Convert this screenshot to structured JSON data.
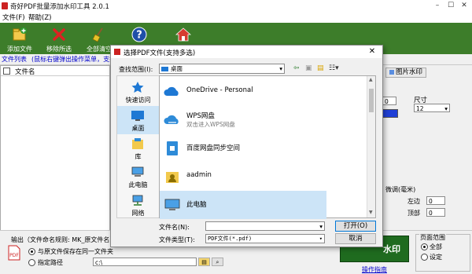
{
  "app": {
    "title": "奇好PDF批量添加水印工具 2.0.1",
    "menu": [
      "文件(F)",
      "帮助(Z)"
    ]
  },
  "toolbar": {
    "items": [
      {
        "label": "添加文件",
        "icon": "add-file-icon"
      },
      {
        "label": "移除所选",
        "icon": "remove-icon"
      },
      {
        "label": "全部清空",
        "icon": "broom-icon"
      },
      {
        "label": "",
        "icon": "help-icon"
      },
      {
        "label": "",
        "icon": "home-icon"
      }
    ]
  },
  "file_list": {
    "tab_label": "文件列表",
    "hint": "(鼠标右键弹出操作菜单，支持",
    "column_filename": "文件名"
  },
  "right_panel": {
    "image_watermark_tab": "图片水印",
    "size_label": "尺寸",
    "size_value": "12",
    "zero_value": "0",
    "margin_label": "微调(毫米)",
    "left_label": "左边",
    "top_label": "顶部",
    "left_value": "0",
    "top_value": "0",
    "page_range_label": "页面范围",
    "page_range_options": [
      "全部",
      "设定"
    ],
    "start_button": "水印",
    "guide_link": "操作指南"
  },
  "output": {
    "label": "输出（文件命名规则: MK_原文件名）",
    "option_same_folder": "与原文件保存在同一文件夹",
    "option_custom_path": "指定路径",
    "path_value": "c:\\"
  },
  "dialog": {
    "title": "选择PDF文件(支持多选)",
    "lookin_label": "查找范围(I):",
    "lookin_value": "桌面",
    "places": [
      {
        "label": "快速访问",
        "icon": "quick-access-icon"
      },
      {
        "label": "桌面",
        "icon": "desktop-icon"
      },
      {
        "label": "库",
        "icon": "library-icon"
      },
      {
        "label": "此电脑",
        "icon": "this-pc-icon"
      },
      {
        "label": "网络",
        "icon": "network-icon"
      }
    ],
    "files": [
      {
        "name": "OneDrive - Personal",
        "sub": "",
        "icon": "onedrive-icon"
      },
      {
        "name": "WPS网盘",
        "sub": "双击进入WPS网盘",
        "icon": "wps-cloud-icon"
      },
      {
        "name": "百度网盘同步空间",
        "sub": "",
        "icon": "baidu-netdisk-icon"
      },
      {
        "name": "aadmin",
        "sub": "",
        "icon": "user-folder-icon"
      },
      {
        "name": "此电脑",
        "sub": "",
        "icon": "computer-icon"
      }
    ],
    "filename_label": "文件名(N):",
    "filename_value": "",
    "filetype_label": "文件类型(T):",
    "filetype_value": "PDF文件(*.pdf)",
    "open_button": "打开(O)",
    "cancel_button": "取消"
  },
  "colors": {
    "toolbar_green": "#3d7d2a",
    "selection_blue": "#cce4f7",
    "start_button_green": "#1f6b1f"
  }
}
